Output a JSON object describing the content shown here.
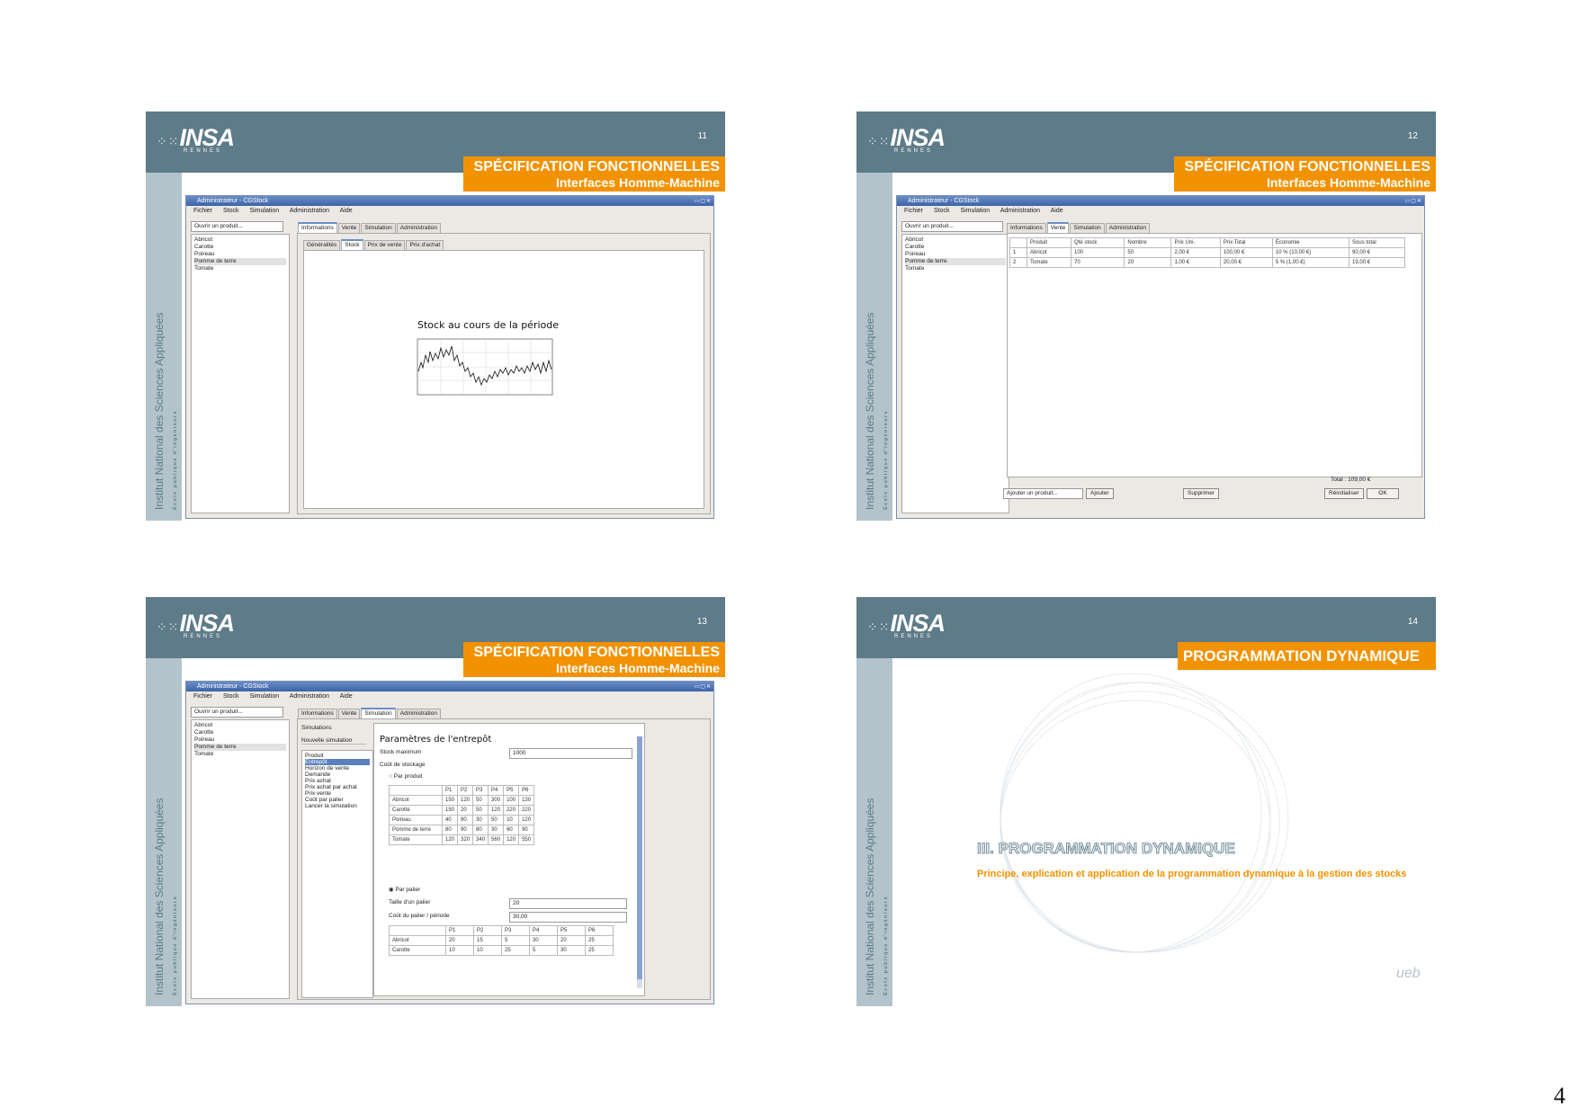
{
  "page_number": "4",
  "institute": {
    "logo_word": "INSA",
    "logo_sub": "RENNES",
    "vertical_title": "Institut National des Sciences Appliquées",
    "vertical_sub": "École publique d'ingénieurs"
  },
  "colors": {
    "header": "#5d7b88",
    "sidebar": "#b2c3cb",
    "band": "#f39200"
  },
  "slides": {
    "s11": {
      "number": "11",
      "title": "SPÉCIFICATION FONCTIONNELLES",
      "subtitle": "Interfaces Homme-Machine",
      "window_title": "Administrateur - CGStock",
      "menu": [
        "Fichier",
        "Stock",
        "Simulation",
        "Administration",
        "Aide"
      ],
      "combo": "Ouvrir un produit...",
      "products": [
        "Abricot",
        "Carotte",
        "Poireau",
        "Pomme de terre",
        "Tomate"
      ],
      "tabs": [
        "Informations",
        "Vente",
        "Simulation",
        "Administration"
      ],
      "subtabs": [
        "Généralités",
        "Stock",
        "Prix de vente",
        "Prix d'achat"
      ],
      "chart_title": "Stock au cours de la période"
    },
    "s12": {
      "number": "12",
      "title": "SPÉCIFICATION FONCTIONNELLES",
      "subtitle": "Interfaces Homme-Machine",
      "window_title": "Administrateur - CGStock",
      "menu": [
        "Fichier",
        "Stock",
        "Simulation",
        "Administration",
        "Aide"
      ],
      "combo": "Ouvrir un produit...",
      "products": [
        "Abricot",
        "Carotte",
        "Poireau",
        "Pomme de terre",
        "Tomate"
      ],
      "tabs": [
        "Informations",
        "Vente",
        "Simulation",
        "Administration"
      ],
      "table_headers": [
        "",
        "Produit",
        "Qté stock",
        "Nombre",
        "Prix Uni.",
        "Prix Total",
        "Économie",
        "Sous total"
      ],
      "table_rows": [
        [
          "1",
          "Abricot",
          "100",
          "50",
          "2,00 €",
          "100,00 €",
          "10 % (10,00 €)",
          "90,00 €"
        ],
        [
          "2",
          "Tomate",
          "70",
          "20",
          "1,00 €",
          "20,00 €",
          "5 % (1,00 €)",
          "19,00 €"
        ]
      ],
      "total": "Total : 109,00 €",
      "add_combo": "Ajouter un produit...",
      "btn_add": "Ajouter",
      "btn_delete": "Supprimer",
      "btn_reset": "Réinitialiser",
      "btn_ok": "OK"
    },
    "s13": {
      "number": "13",
      "title": "SPÉCIFICATION FONCTIONNELLES",
      "subtitle": "Interfaces Homme-Machine",
      "window_title": "Administrateur - CGStock",
      "menu": [
        "Fichier",
        "Stock",
        "Simulation",
        "Administration",
        "Aide"
      ],
      "combo": "Ouvrir un produit...",
      "products": [
        "Abricot",
        "Carotte",
        "Poireau",
        "Pomme de terre",
        "Tomate"
      ],
      "tabs": [
        "Informations",
        "Vente",
        "Simulation",
        "Administration"
      ],
      "sim_header": "Simulations",
      "sim_new": "Nouvelle simulation",
      "sim_steps": [
        "Produit",
        "Entrepôt",
        "Horizon de vente",
        "Demande",
        "Prix achat",
        "Prix achat par achat",
        "Prix vente",
        "Coût par palier",
        "Lancer la simulation"
      ],
      "params_title": "Paramètres de l'entrepôt",
      "stock_max_label": "Stock maximum",
      "stock_max_value": "1000",
      "cost_label": "Coût de stockage",
      "per_unit_label": "Par produit",
      "grid1_headers": [
        "",
        "P1",
        "P2",
        "P3",
        "P4",
        "P5",
        "P6"
      ],
      "grid1_rows": [
        [
          "Abricot",
          "150",
          "120",
          "50",
          "300",
          "100",
          "130"
        ],
        [
          "Carotte",
          "150",
          "20",
          "50",
          "120",
          "220",
          "220"
        ],
        [
          "Poireau",
          "40",
          "90",
          "30",
          "50",
          "10",
          "120"
        ],
        [
          "Pomme de terre",
          "80",
          "90",
          "80",
          "30",
          "60",
          "90"
        ],
        [
          "Tomate",
          "120",
          "320",
          "340",
          "560",
          "120",
          "550"
        ]
      ],
      "per_level_label": "Par palier",
      "level_size_label": "Taille d'un palier",
      "level_size_value": "20",
      "level_cost_label": "Coût du palier / période",
      "level_cost_value": "30,00",
      "grid2_headers": [
        "",
        "P1",
        "P2",
        "P3",
        "P4",
        "P5",
        "P6"
      ],
      "grid2_rows": [
        [
          "Abricot",
          "20",
          "15",
          "5",
          "30",
          "20",
          "25"
        ],
        [
          "Carotte",
          "10",
          "10",
          "25",
          "5",
          "30",
          "25"
        ]
      ]
    },
    "s14": {
      "number": "14",
      "title": "PROGRAMMATION DYNAMIQUE",
      "section_title": "III. PROGRAMMATION DYNAMIQUE",
      "section_desc": "Principe, explication et application de la programmation dynamique à la gestion des stocks",
      "ueb": "ueb"
    }
  }
}
